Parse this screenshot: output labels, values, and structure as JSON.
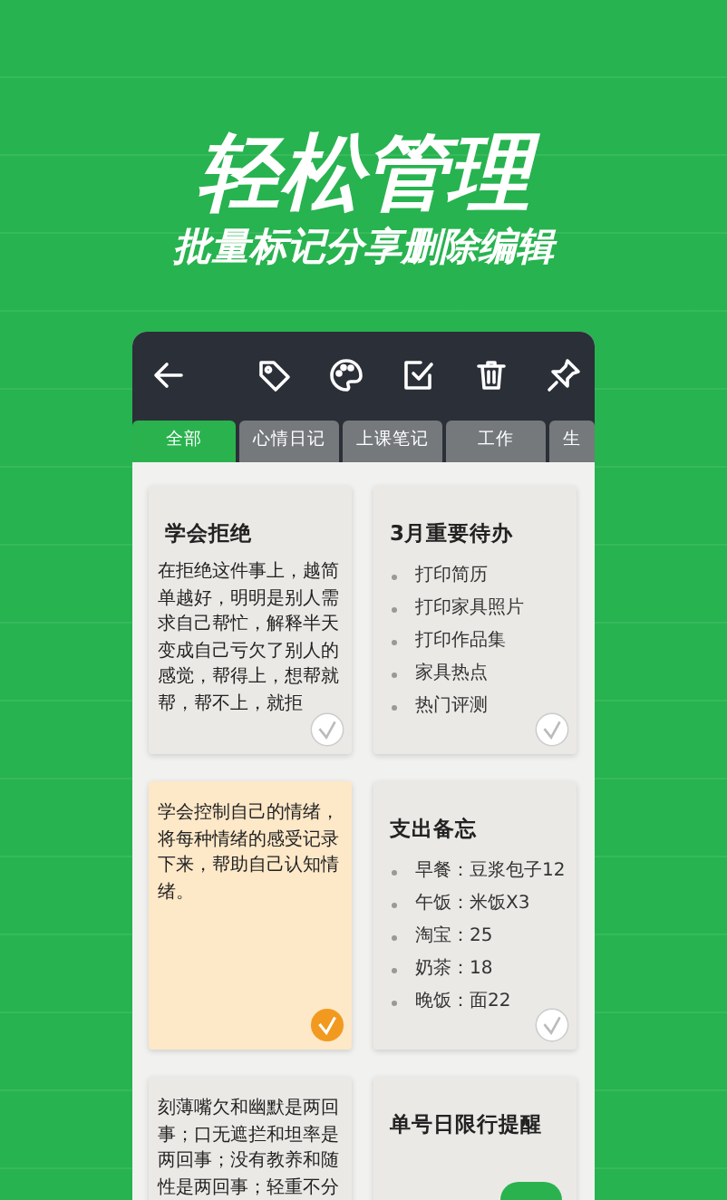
{
  "headline": "轻松管理",
  "subtitle": "批量标记分享删除编辑",
  "tabs": [
    {
      "label": "全部",
      "selected": true
    },
    {
      "label": "心情日记",
      "selected": false
    },
    {
      "label": "上课笔记",
      "selected": false
    },
    {
      "label": "工作",
      "selected": false
    },
    {
      "label": "生",
      "selected": false
    }
  ],
  "notes": [
    {
      "kind": "text",
      "title": "学会拒绝",
      "body": "在拒绝这件事上，越简单越好，明明是别人需求自己帮忙，解释半天变成自己亏欠了别人的感觉，帮得上，想帮就帮，帮不上，就拒",
      "checked": false,
      "color": "#ebe9e6"
    },
    {
      "kind": "list",
      "title": "3月重要待办",
      "items": [
        "打印简历",
        "打印家具照片",
        "打印作品集",
        "家具热点",
        "热门评测"
      ],
      "checked": false,
      "color": "#ebe9e6"
    },
    {
      "kind": "text",
      "body": "学会控制自己的情绪，将每种情绪的感受记录下来，帮助自己认知情绪。",
      "checked": true,
      "color": "#fde8c8"
    },
    {
      "kind": "list",
      "title": "支出备忘",
      "items": [
        "早餐：豆浆包子12",
        "午饭：米饭X3",
        "淘宝：25",
        "奶茶：18",
        "晚饭：面22"
      ],
      "checked": false,
      "color": "#ebe9e6"
    },
    {
      "kind": "text",
      "body": "刻薄嘴欠和幽默是两回事；口无遮拦和坦率是两回事；没有教养和随性是两回事；轻重不分",
      "color": "#ebe9e6"
    },
    {
      "kind": "text",
      "title": "单号日限行提醒",
      "color": "#ebe9e6"
    }
  ]
}
